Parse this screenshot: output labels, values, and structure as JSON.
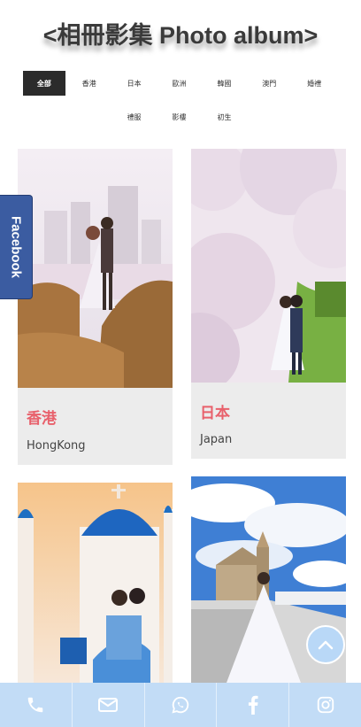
{
  "page": {
    "title": "<相冊影集 Photo album>"
  },
  "filters": {
    "row1": [
      "全部",
      "香港",
      "日本",
      "歐洲",
      "韓國",
      "澳門",
      "婚禮"
    ],
    "row2": [
      "禮服",
      "影樓",
      "初生"
    ],
    "active": "全部"
  },
  "cards": [
    {
      "title": "香港",
      "subtitle": "HongKong"
    },
    {
      "title": "日本",
      "subtitle": "Japan"
    },
    {
      "title": "",
      "subtitle": ""
    },
    {
      "title": "",
      "subtitle": ""
    }
  ],
  "side_tab": {
    "label": "Facebook"
  },
  "bottom_bar": {
    "items": [
      "phone-icon",
      "email-icon",
      "whatsapp-icon",
      "facebook-icon",
      "instagram-icon"
    ]
  },
  "colors": {
    "accent_red": "#e8616c",
    "active_filter": "#2b2b2b",
    "bottom_bar": "#c2dcf6",
    "facebook_blue": "#3b5ca1"
  }
}
